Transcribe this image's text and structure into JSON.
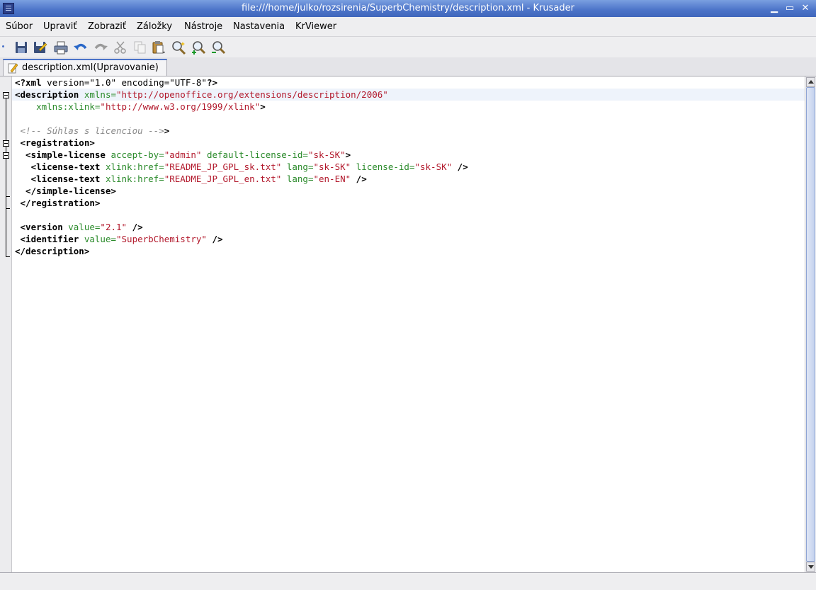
{
  "window": {
    "title": "file:///home/julko/rozsirenia/SuperbChemistry/description.xml - Krusader",
    "minimize_glyph": "▁",
    "maximize_glyph": "▭",
    "close_glyph": "✕"
  },
  "menu": [
    {
      "label": "Súbor"
    },
    {
      "label": "Upraviť"
    },
    {
      "label": "Zobraziť"
    },
    {
      "label": "Záložky"
    },
    {
      "label": "Nástroje"
    },
    {
      "label": "Nastavenia"
    },
    {
      "label": "KrViewer"
    }
  ],
  "toolbar": [
    "save-icon",
    "save-as-icon",
    "print-icon",
    "undo-icon",
    "redo-icon",
    "cut-icon",
    "copy-icon",
    "paste-icon",
    "find-icon",
    "zoom-in-icon",
    "zoom-out-icon",
    "zoom-reset-icon"
  ],
  "tab": {
    "label": "description.xml(Upravovanie)"
  },
  "code": {
    "l1": {
      "t1": "<?xml",
      "t2": " version=\"1.0\" encoding=\"UTF-8\"",
      "t3": "?>"
    },
    "l2": {
      "tag": "<description",
      "attr": " xmlns=",
      "str": "\"http://openoffice.org/extensions/description/2006\""
    },
    "l3": {
      "attr": "    xmlns:xlink=",
      "str": "\"http://www.w3.org/1999/xlink\"",
      "end": ">"
    },
    "l5": {
      "cmt": " <!-- Súhlas s licenciou -->",
      "end": ">"
    },
    "l6": {
      "tag": " <registration>"
    },
    "l7": {
      "tag": "  <simple-license",
      "a1": " accept-by=",
      "s1": "\"admin\"",
      "a2": " default-license-id=",
      "s2": "\"sk-SK\"",
      "end": ">"
    },
    "l8": {
      "tag": "   <license-text",
      "a1": " xlink:href=",
      "s1": "\"README_JP_GPL_sk.txt\"",
      "a2": " lang=",
      "s2": "\"sk-SK\"",
      "a3": " license-id=",
      "s3": "\"sk-SK\"",
      "end": " />"
    },
    "l9": {
      "tag": "   <license-text",
      "a1": " xlink:href=",
      "s1": "\"README_JP_GPL_en.txt\"",
      "a2": " lang=",
      "s2": "\"en-EN\"",
      "end": " />"
    },
    "l10": {
      "tag": "  </simple-license>"
    },
    "l11": {
      "tag": " </registration>"
    },
    "l13": {
      "tag": " <version",
      "a1": " value=",
      "s1": "\"2.1\"",
      "end": " />"
    },
    "l14": {
      "tag": " <identifier",
      "a1": " value=",
      "s1": "\"SuperbChemistry\"",
      "end": " />"
    },
    "l15": {
      "tag": "</description>"
    }
  },
  "colors": {
    "tag": "#000000",
    "attr": "#2a8a2a",
    "string": "#b2182b",
    "comment": "#8a8a8a",
    "titlebar": "#4b73c8"
  }
}
